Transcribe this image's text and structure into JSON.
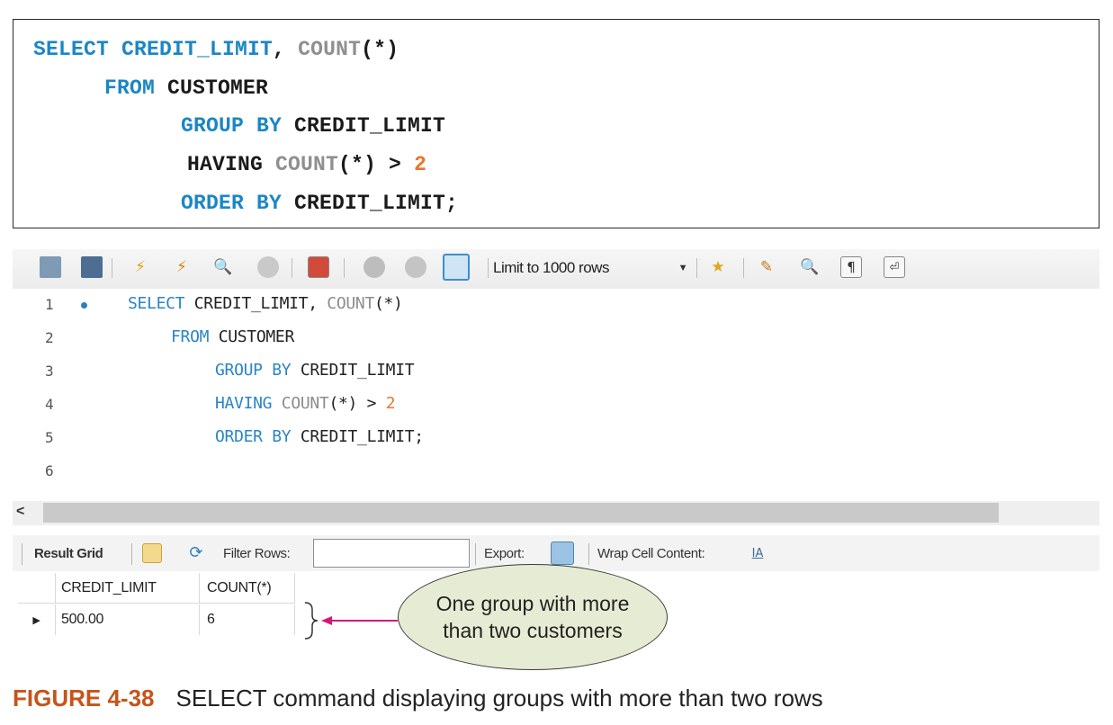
{
  "code_box": {
    "lines": [
      [
        {
          "t": "SELECT CREDIT_LIMIT",
          "c": "kw"
        },
        {
          "t": ", ",
          "c": ""
        },
        {
          "t": "COUNT",
          "c": "fn"
        },
        {
          "t": "(*)",
          "c": ""
        }
      ],
      [
        {
          "t": "FROM ",
          "c": "kw"
        },
        {
          "t": "CUSTOMER",
          "c": ""
        }
      ],
      [
        {
          "t": "GROUP BY ",
          "c": "kw"
        },
        {
          "t": "CREDIT_LIMIT",
          "c": ""
        }
      ],
      [
        {
          "t": "HAVING ",
          "c": ""
        },
        {
          "t": "COUNT",
          "c": "fn"
        },
        {
          "t": "(*) > ",
          "c": ""
        },
        {
          "t": "2",
          "c": "num"
        }
      ],
      [
        {
          "t": "ORDER BY ",
          "c": "kw"
        },
        {
          "t": "CREDIT_LIMIT;",
          "c": ""
        }
      ]
    ]
  },
  "toolbar": {
    "icons": [
      "folder-icon",
      "save-icon",
      "execute-icon",
      "execute-current-icon",
      "explain-icon",
      "stop-icon",
      "toggle-output-icon",
      "commit-icon",
      "rollback-icon",
      "autocommit-icon",
      "add-snippet-icon",
      "beautify-icon",
      "find-icon",
      "invisible-chars-icon",
      "wrap-lines-icon"
    ],
    "limit_label": "Limit to 1000 rows"
  },
  "editor": {
    "line_numbers": [
      "1",
      "2",
      "3",
      "4",
      "5",
      "6"
    ],
    "lines": [
      [
        {
          "t": "SELECT",
          "c": "kw"
        },
        {
          "t": " CREDIT_LIMIT, ",
          "c": ""
        },
        {
          "t": "COUNT",
          "c": "fn"
        },
        {
          "t": "(*)",
          "c": ""
        }
      ],
      [
        {
          "t": "FROM",
          "c": "kw"
        },
        {
          "t": " CUSTOMER",
          "c": ""
        }
      ],
      [
        {
          "t": "GROUP BY",
          "c": "kw"
        },
        {
          "t": " CREDIT_LIMIT",
          "c": ""
        }
      ],
      [
        {
          "t": "HAVING",
          "c": "kw"
        },
        {
          "t": " ",
          "c": ""
        },
        {
          "t": "COUNT",
          "c": "fn"
        },
        {
          "t": "(*) > ",
          "c": ""
        },
        {
          "t": "2",
          "c": "num"
        }
      ],
      [
        {
          "t": "ORDER BY",
          "c": "kw"
        },
        {
          "t": " CREDIT_LIMIT;",
          "c": ""
        }
      ],
      []
    ]
  },
  "scroll_arrow": "<",
  "result_bar": {
    "result_grid_label": "Result Grid",
    "filter_label": "Filter Rows:",
    "filter_value": "",
    "export_label": "Export:",
    "wrap_label": "Wrap Cell Content:"
  },
  "grid": {
    "columns": [
      "CREDIT_LIMIT",
      "COUNT(*)"
    ],
    "rows": [
      [
        "500.00",
        "6"
      ]
    ]
  },
  "callout": {
    "line1": "One group with more",
    "line2": "than two customers"
  },
  "caption": {
    "figure": "FIGURE 4-38",
    "text": "SELECT command displaying groups with more than two rows"
  },
  "colors": {
    "keyword": "#1b86c4",
    "function": "#8f8f8f",
    "number": "#e8772e",
    "callout_fill": "#e6ecd3",
    "arrow": "#d4177a",
    "figure_label": "#c4551a"
  }
}
